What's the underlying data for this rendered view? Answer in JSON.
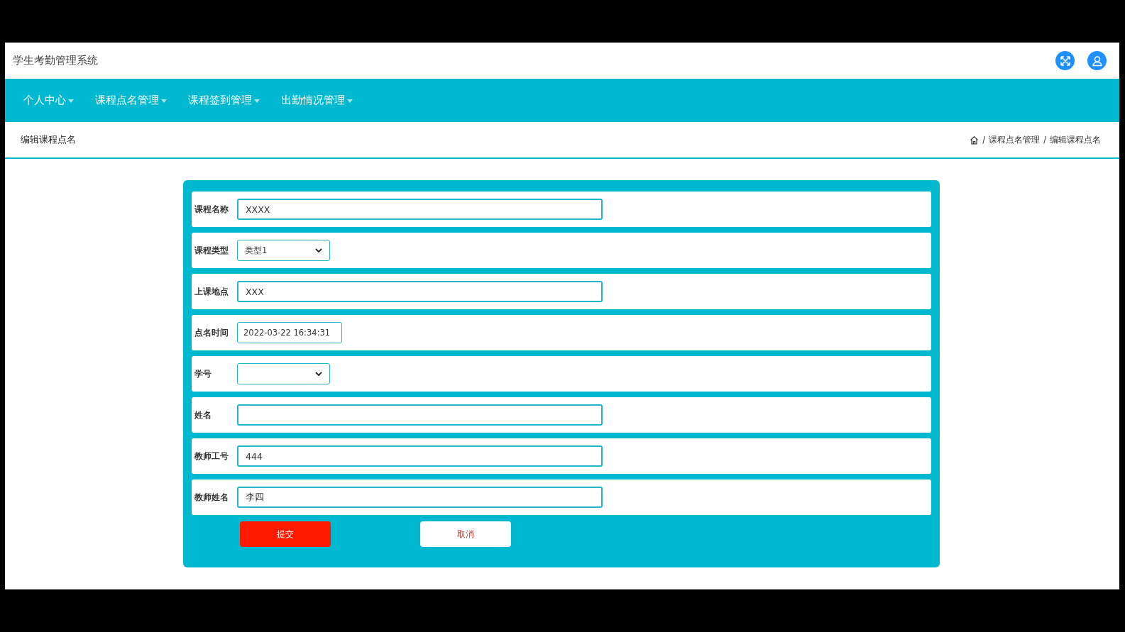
{
  "header": {
    "title": "学生考勤管理系统"
  },
  "nav": [
    {
      "label": "个人中心"
    },
    {
      "label": "课程点名管理"
    },
    {
      "label": "课程签到管理"
    },
    {
      "label": "出勤情况管理"
    }
  ],
  "page": {
    "title": "编辑课程点名",
    "breadcrumb": [
      "课程点名管理",
      "编辑课程点名"
    ],
    "breadcrumb_separator": "/"
  },
  "form": {
    "fields": [
      {
        "label": "课程名称",
        "kind": "text",
        "value": "XXXX"
      },
      {
        "label": "课程类型",
        "kind": "select",
        "value": "类型1"
      },
      {
        "label": "上课地点",
        "kind": "text",
        "value": "XXX"
      },
      {
        "label": "点名时间",
        "kind": "date",
        "value": "2022-03-22 16:34:31"
      },
      {
        "label": "学号",
        "kind": "select"
      },
      {
        "label": "姓名",
        "kind": "text"
      },
      {
        "label": "教师工号",
        "kind": "text",
        "value": "444"
      },
      {
        "label": "教师姓名",
        "kind": "text",
        "value": "李四"
      }
    ],
    "buttons": [
      {
        "label": "提交",
        "kind": "primary"
      },
      {
        "label": "取消",
        "kind": "secondary"
      }
    ]
  }
}
